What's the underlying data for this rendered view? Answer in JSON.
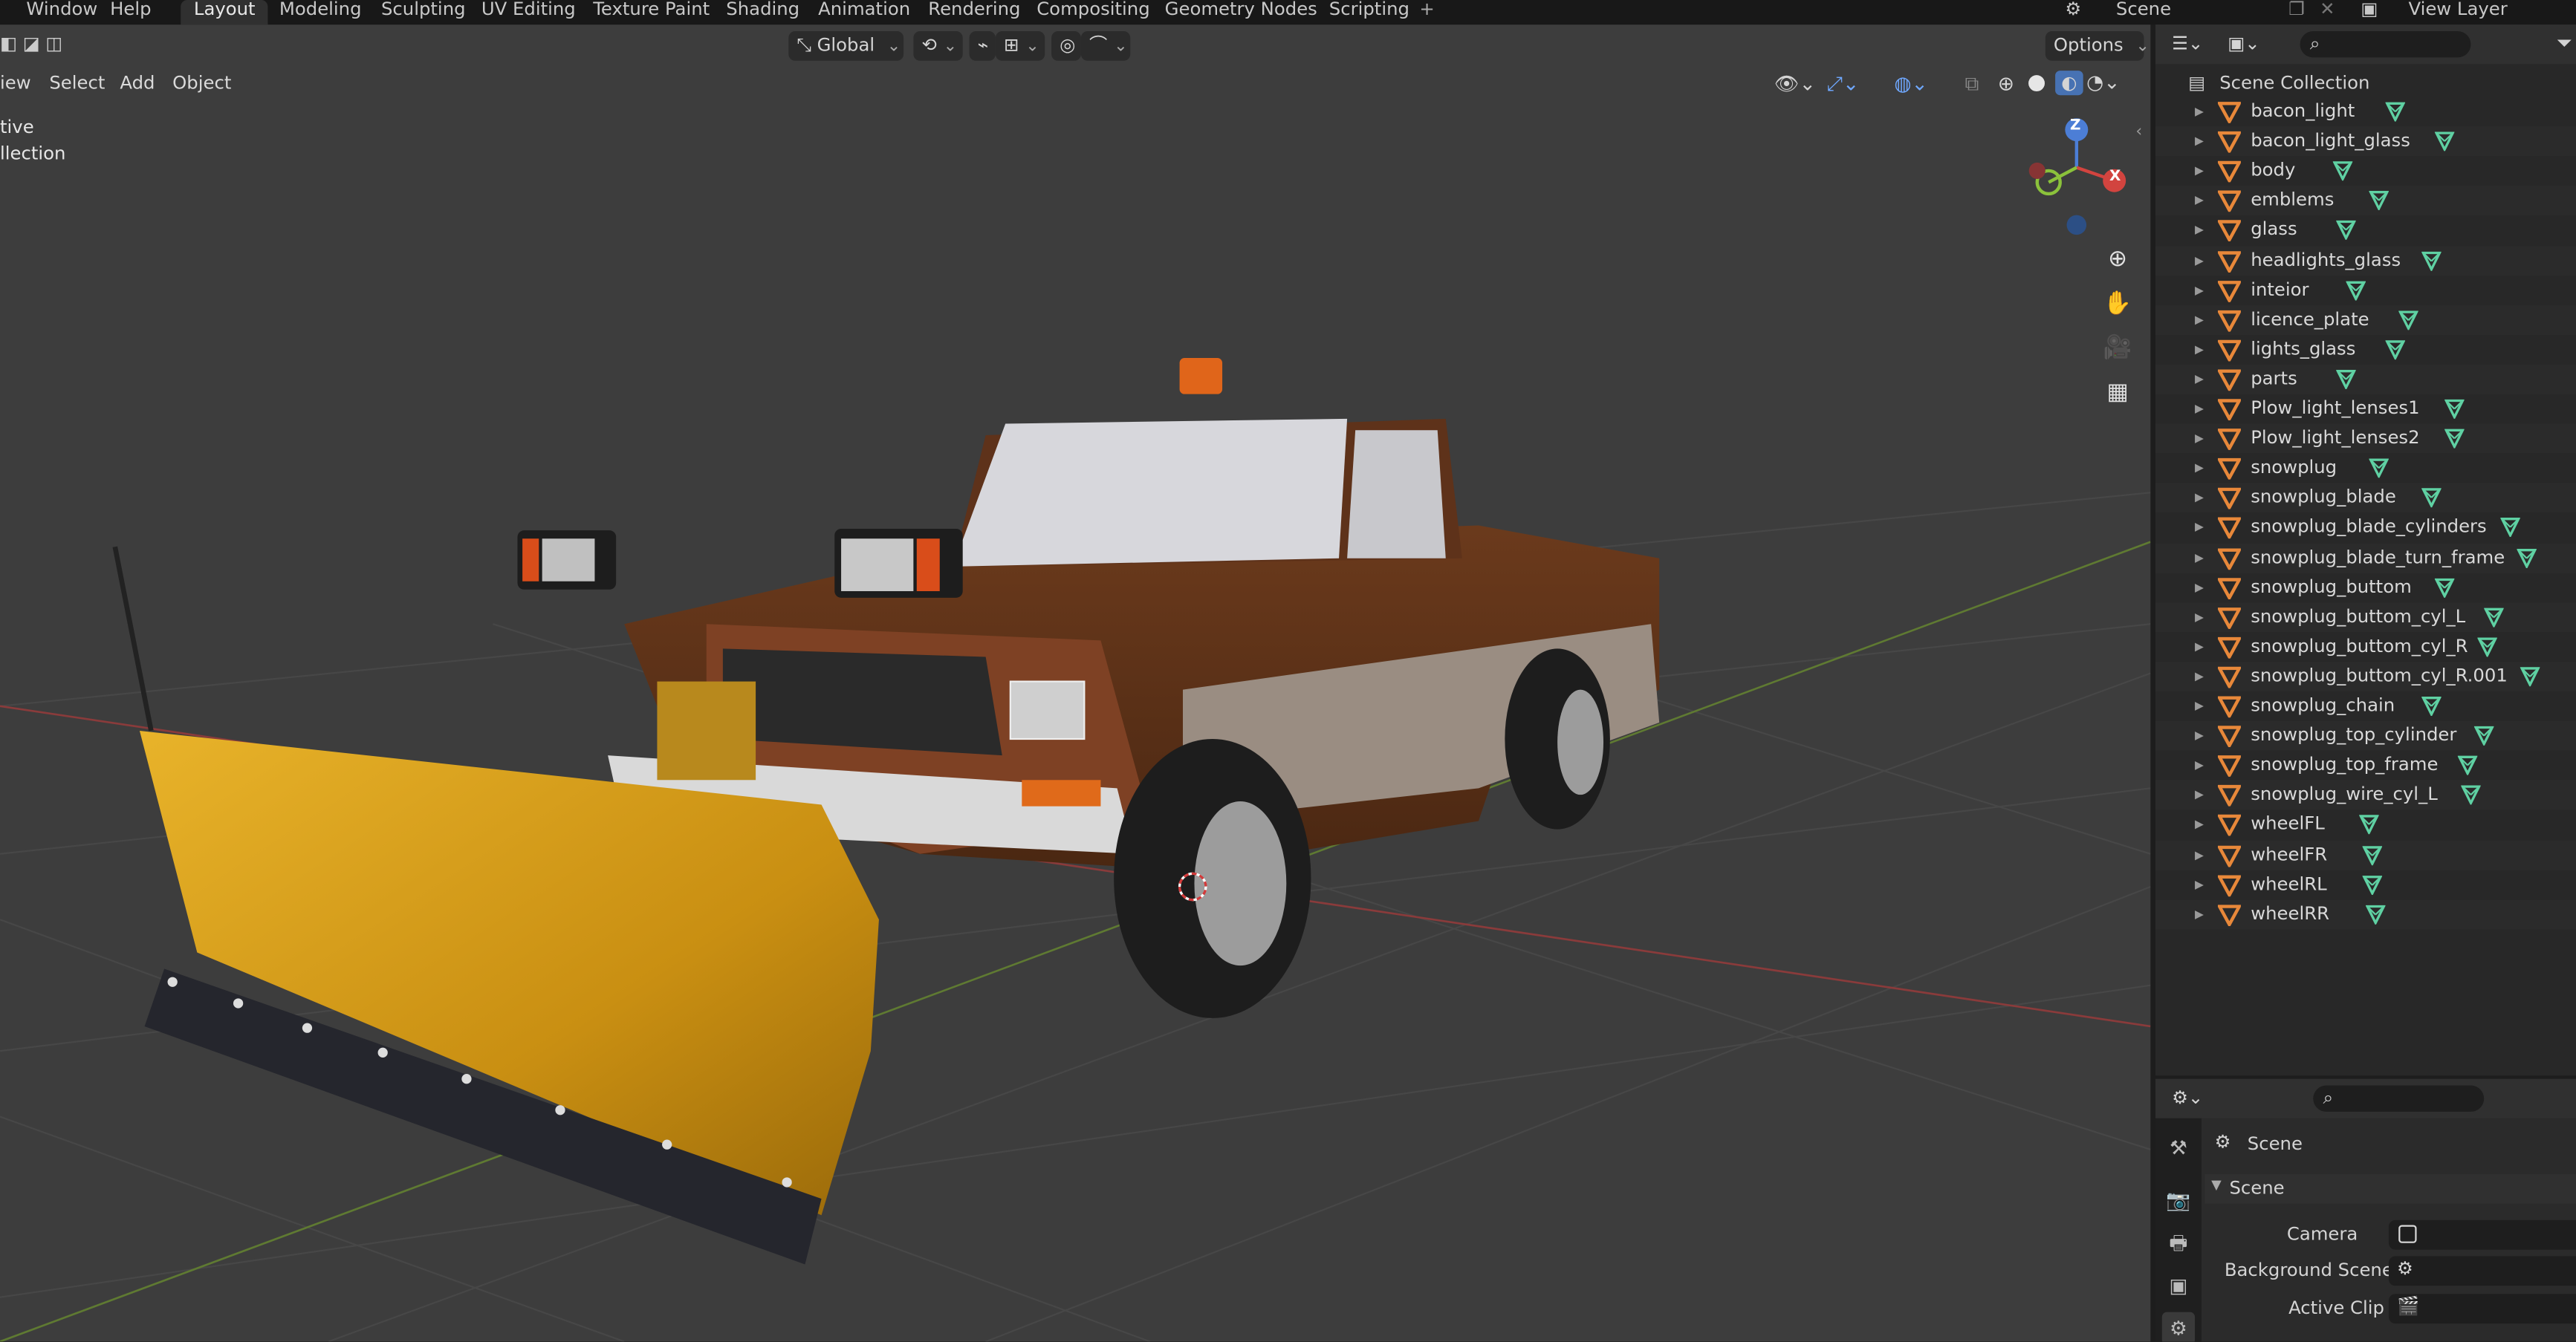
{
  "menubar": {
    "window": "Window",
    "help": "Help",
    "workspaces": [
      "Layout",
      "Modeling",
      "Sculpting",
      "UV Editing",
      "Texture Paint",
      "Shading",
      "Animation",
      "Rendering",
      "Compositing",
      "Geometry Nodes",
      "Scripting"
    ],
    "active_workspace": "Layout",
    "add_tab": "+",
    "scene": "Scene",
    "view_layer": "View Layer"
  },
  "viewport": {
    "menu": [
      "iew",
      "Select",
      "Add",
      "Object"
    ],
    "orientation": "Global",
    "options": "Options",
    "info_line1": "tive",
    "info_line2": "llection",
    "gizmo_z": "Z",
    "gizmo_x": "X"
  },
  "outliner": {
    "collection": "Scene Collection",
    "items": [
      "bacon_light",
      "bacon_light_glass",
      "body",
      "emblems",
      "glass",
      "headlights_glass",
      "inteior",
      "licence_plate",
      "lights_glass",
      "parts",
      "Plow_light_lenses1",
      "Plow_light_lenses2",
      "snowplug",
      "snowplug_blade",
      "snowplug_blade_cylinders",
      "snowplug_blade_turn_frame",
      "snowplug_buttom",
      "snowplug_buttom_cyl_L",
      "snowplug_buttom_cyl_R",
      "snowplug_buttom_cyl_R.001",
      "snowplug_chain",
      "snowplug_top_cylinder",
      "snowplug_top_frame",
      "snowplug_wire_cyl_L",
      "wheelFL",
      "wheelFR",
      "wheelRL",
      "wheelRR"
    ]
  },
  "properties": {
    "context": "Scene",
    "panel": "Scene",
    "camera_label": "Camera",
    "background_label": "Background Scene",
    "clip_label": "Active Clip"
  },
  "colors": {
    "accent_orange": "#e8883a",
    "mesh_green": "#5fd1a3",
    "viewport_bg": "#3d3d3d"
  }
}
